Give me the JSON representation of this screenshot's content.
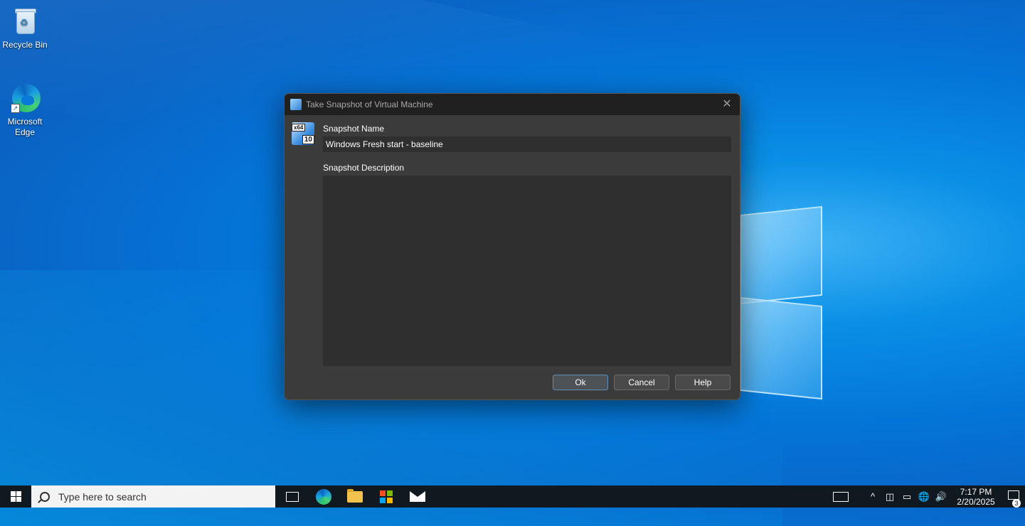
{
  "desktop": {
    "icons": [
      {
        "label": "Recycle Bin",
        "icon": "recycle-bin-icon"
      },
      {
        "label": "Microsoft Edge",
        "icon": "edge-icon"
      }
    ]
  },
  "dialog": {
    "title": "Take Snapshot of Virtual Machine",
    "close_glyph": "✕",
    "vm_badge": "x64",
    "vm_badge2": "10",
    "name_label": "Snapshot Name",
    "name_value": "Windows Fresh start - baseline",
    "description_label": "Snapshot Description",
    "description_value": "",
    "buttons": {
      "ok": "Ok",
      "cancel": "Cancel",
      "help": "Help"
    }
  },
  "taskbar": {
    "search_placeholder": "Type here to search",
    "apps": [
      "task-view-icon",
      "edge-icon",
      "file-explorer-icon",
      "microsoft-store-icon",
      "mail-icon"
    ],
    "tray": {
      "chevron": "^",
      "time": "7:17 PM",
      "date": "2/20/2025",
      "notification_count": "3"
    }
  }
}
